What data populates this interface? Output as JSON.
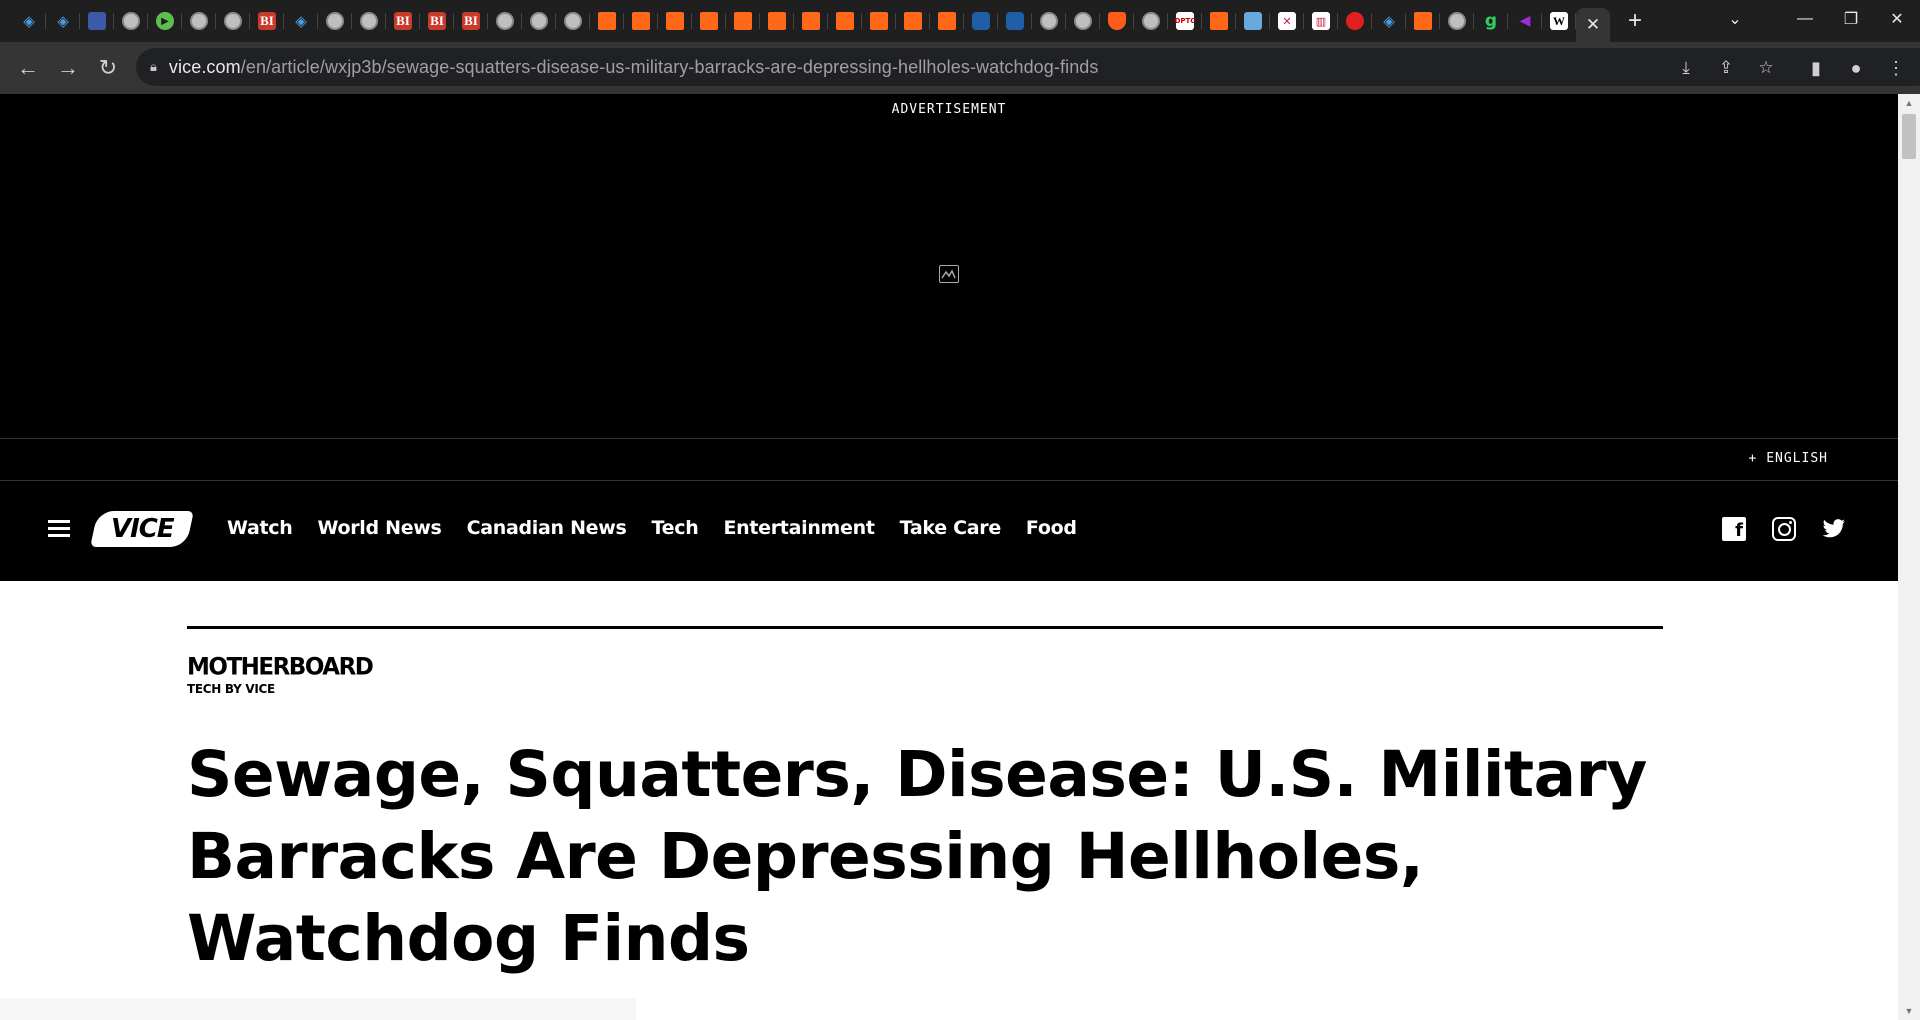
{
  "browser": {
    "tabs_favicons": [
      {
        "icon": "shield-icon",
        "kind": "shield",
        "glyph": "◈"
      },
      {
        "icon": "shield-icon",
        "kind": "shield",
        "glyph": "◈"
      },
      {
        "icon": "tag-icon",
        "kind": "blue-d",
        "glyph": ""
      },
      {
        "icon": "globe-icon",
        "kind": "globe",
        "glyph": ""
      },
      {
        "icon": "play-icon",
        "kind": "play",
        "glyph": "▶"
      },
      {
        "icon": "globe-icon",
        "kind": "globe",
        "glyph": ""
      },
      {
        "icon": "globe-icon",
        "kind": "globe",
        "glyph": ""
      },
      {
        "icon": "bi-icon",
        "kind": "bi",
        "glyph": "BI"
      },
      {
        "icon": "shield-icon",
        "kind": "shield",
        "glyph": "◈"
      },
      {
        "icon": "globe-icon",
        "kind": "globe",
        "glyph": ""
      },
      {
        "icon": "globe-icon",
        "kind": "globe",
        "glyph": ""
      },
      {
        "icon": "bi-icon",
        "kind": "bi",
        "glyph": "BI"
      },
      {
        "icon": "bi-icon",
        "kind": "bi",
        "glyph": "BI"
      },
      {
        "icon": "bi-icon",
        "kind": "bi",
        "glyph": "BI"
      },
      {
        "icon": "globe-icon",
        "kind": "globe",
        "glyph": ""
      },
      {
        "icon": "globe-icon",
        "kind": "globe",
        "glyph": ""
      },
      {
        "icon": "globe-icon",
        "kind": "globe",
        "glyph": ""
      },
      {
        "icon": "substack-icon",
        "kind": "sub",
        "glyph": ""
      },
      {
        "icon": "substack-icon",
        "kind": "sub",
        "glyph": ""
      },
      {
        "icon": "substack-icon",
        "kind": "sub",
        "glyph": ""
      },
      {
        "icon": "substack-icon",
        "kind": "sub",
        "glyph": ""
      },
      {
        "icon": "substack-icon",
        "kind": "sub",
        "glyph": ""
      },
      {
        "icon": "substack-icon",
        "kind": "sub",
        "glyph": ""
      },
      {
        "icon": "substack-icon",
        "kind": "sub",
        "glyph": ""
      },
      {
        "icon": "substack-icon",
        "kind": "sub",
        "glyph": ""
      },
      {
        "icon": "substack-icon",
        "kind": "sub",
        "glyph": ""
      },
      {
        "icon": "substack-icon",
        "kind": "sub",
        "glyph": ""
      },
      {
        "icon": "substack-icon",
        "kind": "sub",
        "glyph": ""
      },
      {
        "icon": "cube-icon",
        "kind": "hex",
        "glyph": ""
      },
      {
        "icon": "cube-icon",
        "kind": "hex",
        "glyph": ""
      },
      {
        "icon": "globe-icon",
        "kind": "globe",
        "glyph": ""
      },
      {
        "icon": "globe-icon",
        "kind": "globe",
        "glyph": ""
      },
      {
        "icon": "shield-orange-icon",
        "kind": "shieldo",
        "glyph": ""
      },
      {
        "icon": "globe-icon",
        "kind": "globe",
        "glyph": ""
      },
      {
        "icon": "dptc-icon",
        "kind": "dptc",
        "glyph": "DPTC"
      },
      {
        "icon": "substack-icon",
        "kind": "sub",
        "glyph": ""
      },
      {
        "icon": "flag-icon",
        "kind": "flag",
        "glyph": ""
      },
      {
        "icon": "crest-icon",
        "kind": "ao",
        "glyph": "✕"
      },
      {
        "icon": "bookshelf-icon",
        "kind": "ao",
        "glyph": "▥"
      },
      {
        "icon": "pin-red-icon",
        "kind": "red",
        "glyph": ""
      },
      {
        "icon": "shield-icon",
        "kind": "shield",
        "glyph": "◈"
      },
      {
        "icon": "substack-icon",
        "kind": "sub",
        "glyph": ""
      },
      {
        "icon": "globe-icon",
        "kind": "globe",
        "glyph": ""
      },
      {
        "icon": "g-icon",
        "kind": "green-g",
        "glyph": "g"
      },
      {
        "icon": "wing-icon",
        "kind": "purple",
        "glyph": "◀"
      },
      {
        "icon": "w-icon",
        "kind": "w",
        "glyph": "W"
      }
    ],
    "active_tab_close": "✕",
    "new_tab": "+",
    "window_controls": {
      "dropdown": "⌄",
      "minimize": "—",
      "restore": "❐",
      "close": "✕"
    },
    "nav": {
      "back": "←",
      "forward": "→",
      "reload": "↻"
    },
    "url": {
      "host": "vice.com",
      "path": "/en/article/wxjp3b/sewage-squatters-disease-us-military-barracks-are-depressing-hellholes-watchdog-finds"
    },
    "omnibox_icons": {
      "install": "⤓",
      "share": "⇪",
      "bookmark": "☆"
    },
    "toolbar_icons": {
      "sidepanel": "▮",
      "profile": "●",
      "menu": "⋮"
    }
  },
  "page": {
    "ad_label": "ADVERTISEMENT",
    "language": "+ ENGLISH",
    "site_logo": "VICE",
    "nav_links": [
      "Watch",
      "World News",
      "Canadian News",
      "Tech",
      "Entertainment",
      "Take Care",
      "Food"
    ],
    "social": {
      "facebook": "f",
      "twitter": "🐦"
    },
    "section_logo": "MOTHERBOARD",
    "section_sub": "TECH BY VICE",
    "headline": "Sewage, Squatters, Disease: U.S. Military Barracks Are Depressing Hellholes, Watchdog Finds"
  }
}
